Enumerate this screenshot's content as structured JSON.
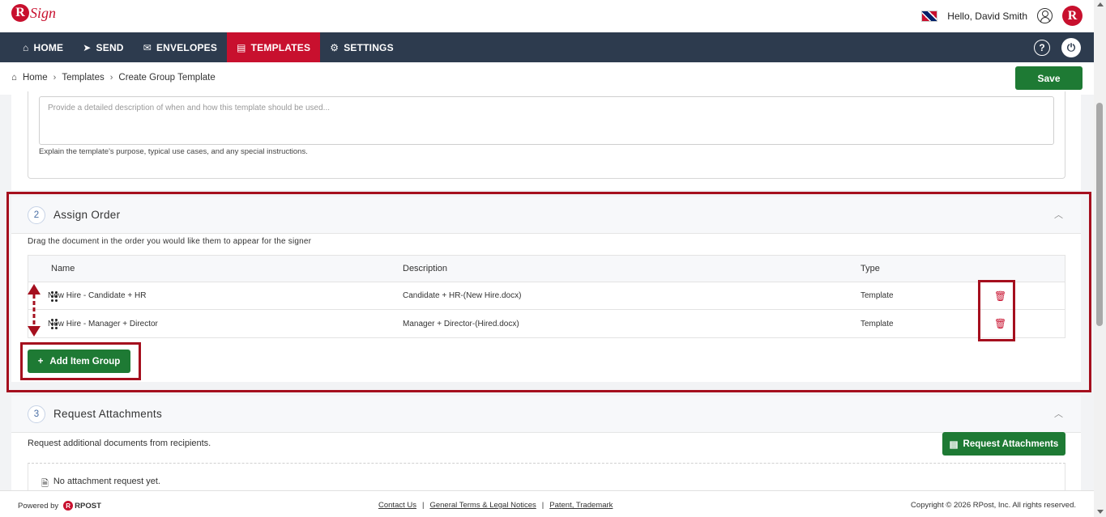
{
  "header": {
    "logo_text": "RSign",
    "greeting": "Hello, David Smith",
    "avatar_letter": "R"
  },
  "nav": {
    "items": [
      {
        "label": "HOME",
        "icon": "home-icon"
      },
      {
        "label": "SEND",
        "icon": "send-icon"
      },
      {
        "label": "ENVELOPES",
        "icon": "envelope-icon"
      },
      {
        "label": "TEMPLATES",
        "icon": "template-icon",
        "active": true
      },
      {
        "label": "SETTINGS",
        "icon": "gear-icon"
      }
    ],
    "help_label": "?"
  },
  "breadcrumb": {
    "items": [
      "Home",
      "Templates",
      "Create Group Template"
    ]
  },
  "toolbar": {
    "save_label": "Save"
  },
  "description": {
    "placeholder": "Provide a detailed description of when and how this template should be used...",
    "hint": "Explain the template's purpose, typical use cases, and any special instructions."
  },
  "assign_order": {
    "number": "2",
    "title": "Assign Order",
    "hint": "Drag the document in the order you would like them to appear for the signer",
    "columns": [
      "Name",
      "Description",
      "Type"
    ],
    "rows": [
      {
        "name": "New Hire - Candidate + HR",
        "description": "Candidate + HR-(New Hire.docx)",
        "type": "Template"
      },
      {
        "name": "New Hire - Manager + Director",
        "description": "Manager + Director-(Hired.docx)",
        "type": "Template"
      }
    ],
    "add_button_label": "Add Item Group"
  },
  "request_attachments": {
    "number": "3",
    "title": "Request Attachments",
    "text": "Request additional documents from recipients.",
    "button_label": "Request Attachments",
    "empty_text": "No attachment request yet."
  },
  "footer": {
    "powered_by": "Powered by",
    "powered_brand": "RPOST",
    "links": [
      "Contact Us",
      "General Terms & Legal Notices",
      "Patent, Trademark"
    ],
    "separator": "|",
    "copyright": "Copyright © 2026 RPost, Inc. All rights reserved."
  },
  "colors": {
    "brand_red": "#c8102e",
    "nav_bg": "#2d3b4e",
    "button_green": "#1e7a34",
    "highlight_red": "#a50f1e"
  }
}
